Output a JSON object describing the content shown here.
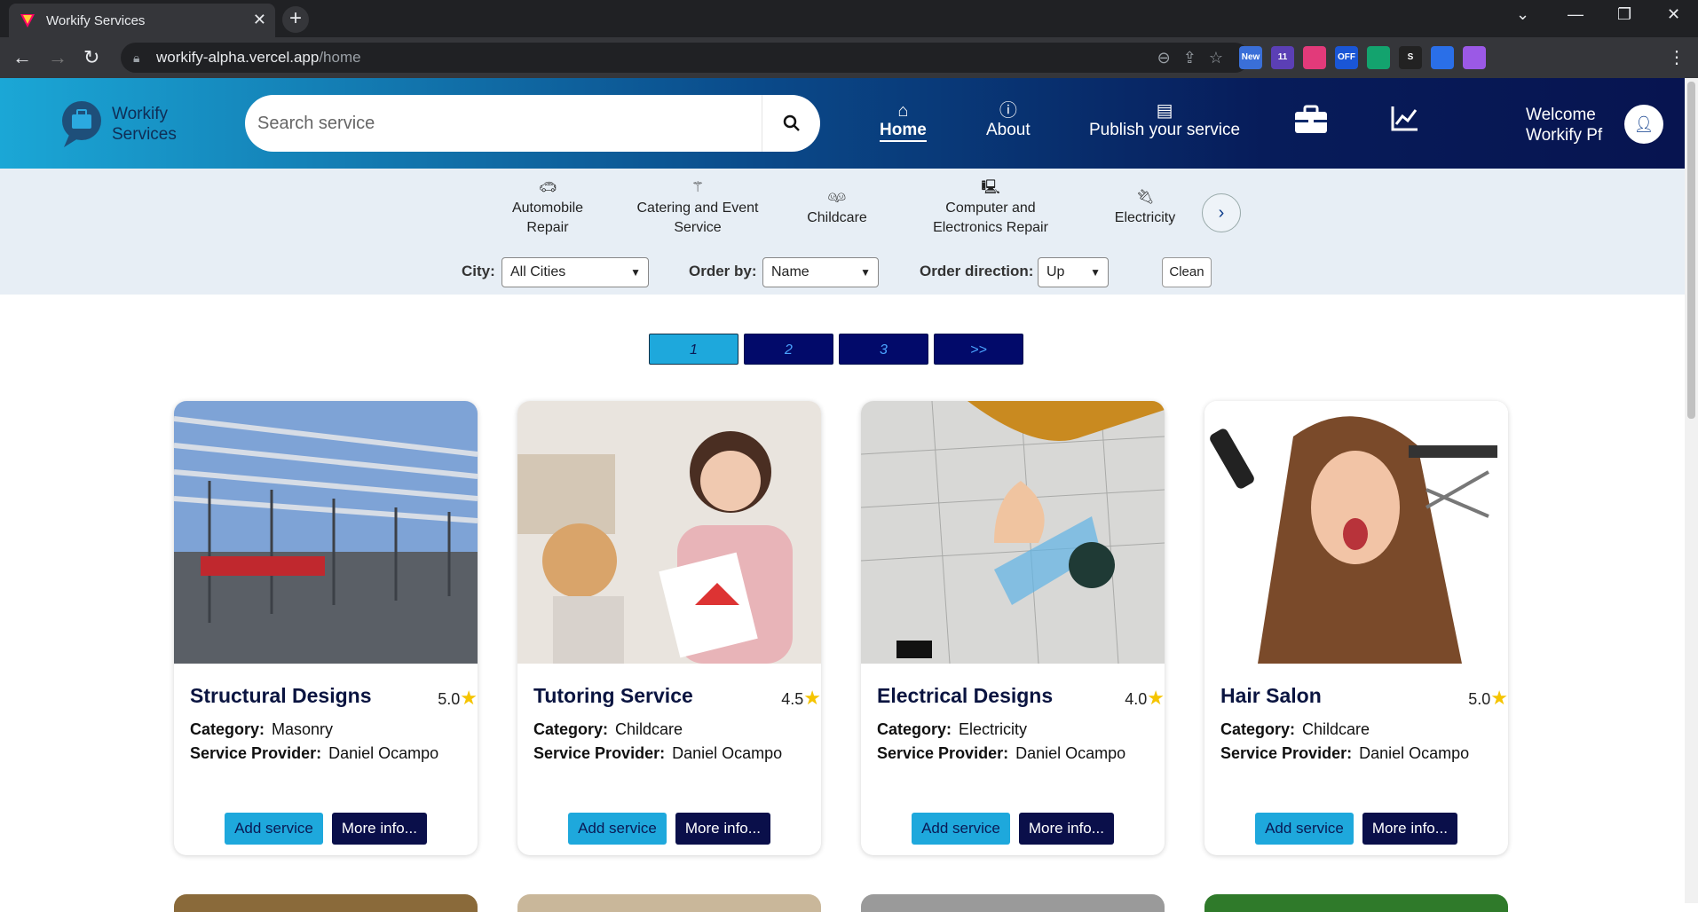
{
  "browser": {
    "tab_title": "Workify Services",
    "url_host": "workify-alpha.vercel.app",
    "url_path": "/home",
    "extensions": [
      {
        "name": "new-extension",
        "label": "New",
        "color": "#3a6fd8"
      },
      {
        "name": "11-extension",
        "label": "11",
        "color": "#5b3fb5"
      },
      {
        "name": "color-extension",
        "label": "",
        "color": "#e23a7a"
      },
      {
        "name": "off-extension",
        "label": "OFF",
        "color": "#1a56d6"
      },
      {
        "name": "green-extension",
        "label": "",
        "color": "#13a36e"
      },
      {
        "name": "s-extension",
        "label": "S",
        "color": "#222222"
      },
      {
        "name": "check-extension",
        "label": "",
        "color": "#2a6fe8"
      },
      {
        "name": "purple-extension",
        "label": "",
        "color": "#9b59e6"
      }
    ]
  },
  "header": {
    "logo_line1": "Workify",
    "logo_line2": "Services",
    "search_placeholder": "Search service",
    "nav": {
      "home": "Home",
      "about": "About",
      "publish": "Publish your service"
    },
    "welcome_line1": "Welcome",
    "welcome_line2": "Workify Pf"
  },
  "categories": [
    {
      "icon": "car-icon",
      "label_line1": "Automobile",
      "label_line2": "Repair"
    },
    {
      "icon": "wand-icon",
      "label_line1": "Catering and Event",
      "label_line2": "Service"
    },
    {
      "icon": "children-icon",
      "label_line1": "Childcare",
      "label_line2": ""
    },
    {
      "icon": "computer-icon",
      "label_line1": "Computer and",
      "label_line2": "Electronics Repair"
    },
    {
      "icon": "plug-icon",
      "label_line1": "Electricity",
      "label_line2": ""
    }
  ],
  "filters": {
    "city_label": "City:",
    "city_value": "All Cities",
    "order_label": "Order by:",
    "order_value": "Name",
    "direction_label": "Order direction:",
    "direction_value": "Up",
    "clean_label": "Clean"
  },
  "pagination": {
    "pages": [
      "1",
      "2",
      "3",
      ">>"
    ],
    "active": "1"
  },
  "services": [
    {
      "title": "Structural Designs",
      "rating": "5.0",
      "category": "Masonry",
      "provider": "Daniel Ocampo"
    },
    {
      "title": "Tutoring Service",
      "rating": "4.5",
      "category": "Childcare",
      "provider": "Daniel Ocampo"
    },
    {
      "title": "Electrical Designs",
      "rating": "4.0",
      "category": "Electricity",
      "provider": "Daniel Ocampo"
    },
    {
      "title": "Hair Salon",
      "rating": "5.0",
      "category": "Childcare",
      "provider": "Daniel Ocampo"
    }
  ],
  "card_labels": {
    "category": "Category:",
    "provider": "Service Provider:",
    "add": "Add service",
    "more": "More info..."
  },
  "colors": {
    "header_start": "#1ba7d6",
    "header_end": "#071450",
    "accent_button": "#1ea8dc",
    "dark_button": "#0a0f4a",
    "star": "#f5c400"
  }
}
